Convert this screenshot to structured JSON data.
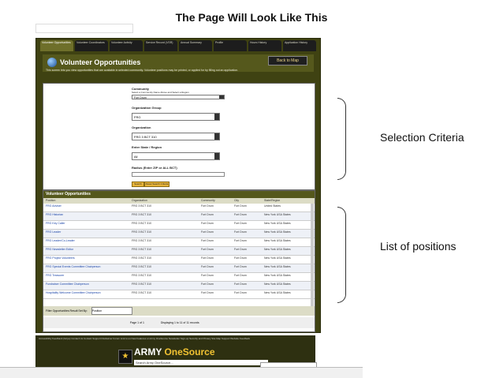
{
  "slide_title": "The Page Will Look Like This",
  "annotations": {
    "selection": "Selection Criteria",
    "list": "List of positions"
  },
  "tabs": [
    "Volunteer Opportunities",
    "Volunteer Coordinators",
    "Volunteer Activity",
    "Service Record (VSR)",
    "Annual Summary",
    "Profile",
    "Hours History",
    "Application History"
  ],
  "header": {
    "title": "Volunteer Opportunities",
    "back_button": "Back to Map"
  },
  "intro": "This screen lets you view opportunities that are available in selected community. Volunteer positions may be printed, or applied for by filling out an application.",
  "form": {
    "community_label": "Community",
    "community_hint": "Select a Community Name Above and Select a Region",
    "community_value": "Fort Drum",
    "org_group_label": "Organization Group",
    "org_group_value": "FRG",
    "organization_label": "Organization",
    "organization_value": "FRG 3 BCT 310",
    "state_label": "Enter State / Region",
    "state_value": "All",
    "radius_label": "Radius (Enter ZIP or ALL BCT)",
    "search_btn": "Search",
    "reset_btn": "Reset Search Criteria"
  },
  "list": {
    "title": "Volunteer Opportunities",
    "columns": [
      "Position",
      "Organization",
      "Community",
      "City",
      "State/Region"
    ],
    "rows": [
      [
        "FRG Adviser",
        "FRG 3 BCT 310",
        "Fort Drum",
        "Fort Drum",
        "United States"
      ],
      [
        "FRG Historian",
        "FRG 3 BCT 310",
        "Fort Drum",
        "Fort Drum",
        "New York USA States"
      ],
      [
        "FRG Key Caller",
        "FRG 3 BCT 310",
        "Fort Drum",
        "Fort Drum",
        "New York USA States"
      ],
      [
        "FRG Leader",
        "FRG 3 BCT 310",
        "Fort Drum",
        "Fort Drum",
        "New York USA States"
      ],
      [
        "FRG Leader/Co-Leader",
        "FRG 3 BCT 310",
        "Fort Drum",
        "Fort Drum",
        "New York USA States"
      ],
      [
        "FRG Newsletter Editor",
        "FRG 3 BCT 310",
        "Fort Drum",
        "Fort Drum",
        "New York USA States"
      ],
      [
        "FRG Project Volunteers",
        "FRG 3 BCT 310",
        "Fort Drum",
        "Fort Drum",
        "New York USA States"
      ],
      [
        "FRG Special Events Committee Chairperson",
        "FRG 3 BCT 310",
        "Fort Drum",
        "Fort Drum",
        "New York USA States"
      ],
      [
        "FRG Treasurer",
        "FRG 3 BCT 310",
        "Fort Drum",
        "Fort Drum",
        "New York USA States"
      ],
      [
        "Fundraiser Committee Chairperson",
        "FRG 3 BCT 310",
        "Fort Drum",
        "Fort Drum",
        "New York USA States"
      ],
      [
        "Hospitality Welcome Committee Chairperson",
        "FRG 3 BCT 310",
        "Fort Drum",
        "Fort Drum",
        "New York USA States"
      ]
    ],
    "filter_label": "Filter Opportunities Result Set By:",
    "filter_value": "Position",
    "pager_text": "Page 1 of 1",
    "pager_count": "Displaying 1 to 11 of 11 records"
  },
  "footer": {
    "links": "Accessibility  Feedback (Gripe)  Contact Us  Contact Support  Disclaimer  Forum  Link to us  New Features on Army OneSource  Newsletter Sign-up  Security and Privacy  Site Map  Support  Website Feedback",
    "brand_1": "ARMY",
    "brand_2": "OneSource",
    "search_placeholder": "Search Army OneSource..."
  }
}
